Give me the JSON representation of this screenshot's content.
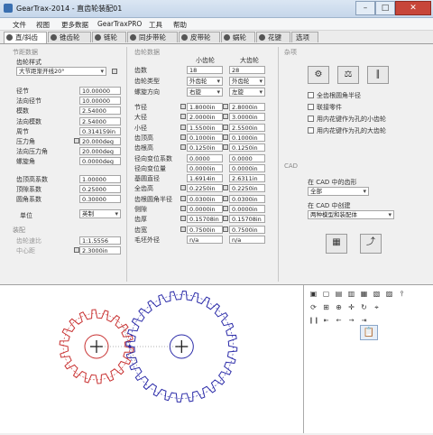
{
  "window": {
    "title": "GearTrax-2014 - 直齿轮装配01"
  },
  "menu": [
    "文件",
    "视图",
    "更多数据",
    "GearTraxPRO",
    "工具",
    "帮助"
  ],
  "tabs": [
    "直/斜齿",
    "锥齿轮",
    "链轮",
    "同步带轮",
    "皮带轮",
    "蜗轮",
    "花键",
    "选项"
  ],
  "pitch": {
    "section": "节距数据",
    "tooth_form_label": "齿轮样式",
    "tooth_form": "大节距渐开线20°",
    "rows": [
      {
        "label": "径节",
        "value": "10.00000"
      },
      {
        "label": "法向径节",
        "value": "10.00000"
      },
      {
        "label": "模数",
        "value": "2.54000"
      },
      {
        "label": "法向模数",
        "value": "2.54000"
      },
      {
        "label": "周节",
        "value": "0.314159in"
      },
      {
        "label": "压力角",
        "value": "20.000deg"
      },
      {
        "label": "法向压力角",
        "value": "20.000deg"
      },
      {
        "label": "螺旋角",
        "value": "0.0000deg"
      }
    ],
    "coef_rows": [
      {
        "label": "齿顶高系数",
        "value": "1.00000"
      },
      {
        "label": "顶隙系数",
        "value": "0.25000"
      },
      {
        "label": "圆角系数",
        "value": "0.30000"
      }
    ],
    "unit_label": "单位",
    "unit": "英制"
  },
  "assembly": {
    "section": "装配",
    "rows": [
      {
        "label": "齿轮速比",
        "value": "1:1.5556"
      },
      {
        "label": "中心距",
        "value": "2.3000in"
      }
    ]
  },
  "gear": {
    "section": "齿轮数据",
    "pinion_head": "小齿轮",
    "gear_head": "大齿轮",
    "top_rows": [
      {
        "label": "齿数",
        "pinion": "18",
        "gear": "28",
        "type": "spin"
      },
      {
        "label": "齿轮类型",
        "pinion": "外齿轮",
        "gear": "外齿轮",
        "type": "select"
      },
      {
        "label": "螺旋方向",
        "pinion": "右旋",
        "gear": "左旋",
        "type": "select"
      }
    ],
    "rows": [
      {
        "label": "节径",
        "pinion": "1.8000in",
        "gear": "2.8000in"
      },
      {
        "label": "大径",
        "pinion": "2.0000in",
        "gear": "3.0000in"
      },
      {
        "label": "小径",
        "pinion": "1.5500in",
        "gear": "2.5500in"
      },
      {
        "label": "齿顶高",
        "pinion": "0.1000in",
        "gear": "0.1000in"
      },
      {
        "label": "齿根高",
        "pinion": "0.1250in",
        "gear": "0.1250in"
      },
      {
        "label": "径向变位系数",
        "pinion": "0.0000",
        "gear": "0.0000"
      },
      {
        "label": "径向变位量",
        "pinion": "0.0000in",
        "gear": "0.0000in"
      },
      {
        "label": "基圆直径",
        "pinion": "1.6914in",
        "gear": "2.6311in"
      },
      {
        "label": "全齿高",
        "pinion": "0.2250in",
        "gear": "0.2250in"
      },
      {
        "label": "齿根圆角半径",
        "pinion": "0.0300in",
        "gear": "0.0300in"
      },
      {
        "label": "侧隙",
        "pinion": "0.0000in",
        "gear": "0.0000in"
      },
      {
        "label": "齿厚",
        "pinion": "0.15708in",
        "gear": "0.15708in"
      },
      {
        "label": "齿宽",
        "pinion": "0.7500in",
        "gear": "0.7500in"
      },
      {
        "label": "毛坯外径",
        "pinion": "n/a",
        "gear": "n/a"
      }
    ]
  },
  "misc": {
    "section": "杂项",
    "buttons": [
      "gear-settings-icon",
      "balance-icon",
      "caliper-icon"
    ],
    "checks": [
      {
        "label": "全齿根圆角半径",
        "checked": false
      },
      {
        "label": "联接零件",
        "checked": false
      },
      {
        "label": "用内花键作为孔的小齿轮",
        "checked": false
      },
      {
        "label": "用内花键作为孔的大齿轮",
        "checked": false
      }
    ]
  },
  "cad": {
    "section": "CAD",
    "model_label": "在 CAD 中的齿形",
    "model_value": "全部",
    "create_label": "在 CAD 中创建",
    "create_value": "两种模型和装配体"
  },
  "viewer": {
    "toolbar_row1": [
      "iso-icon",
      "front-icon",
      "top-icon",
      "right-icon",
      "back-icon",
      "bottom-icon",
      "left-icon",
      "axis-icon"
    ],
    "toolbar_row2": [
      "rotate-icon",
      "zoom-fit-icon",
      "zoom-icon",
      "pan-icon",
      "rotate-view-icon",
      "target-icon"
    ],
    "toolbar_row3": [
      "pause-icon",
      "step-back-icon",
      "rewind-icon",
      "play-icon",
      "step-forward-icon"
    ],
    "colors": {
      "pinion": "#c83030",
      "gear": "#2a2aa8"
    },
    "pinion_teeth": 18,
    "gear_teeth": 28,
    "pinion_pitch_dia": 1.8,
    "gear_pitch_dia": 2.8,
    "center_distance": 2.3
  }
}
